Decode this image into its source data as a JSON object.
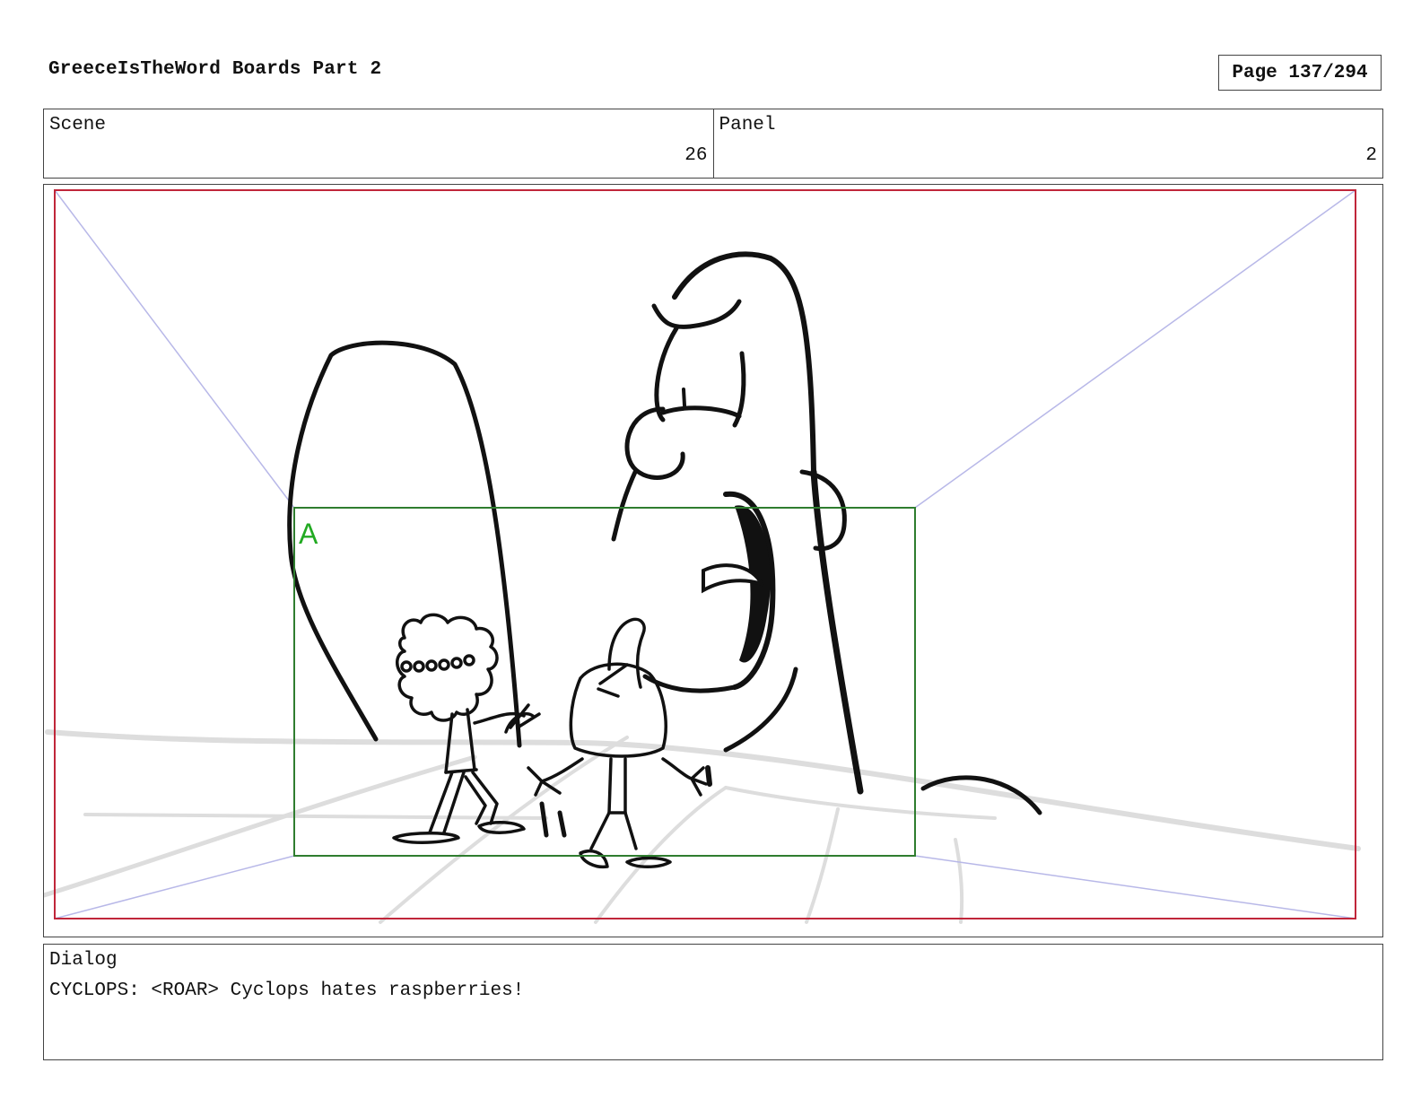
{
  "header": {
    "title": "GreeceIsTheWord Boards Part 2",
    "page_label": "Page 137/294"
  },
  "info": {
    "scene_label": "Scene",
    "scene_value": "26",
    "panel_label": "Panel",
    "panel_value": "2"
  },
  "panel": {
    "camera_marker": "A",
    "colors": {
      "safe_frame": "#c0263a",
      "camera_frame": "#2f7d2f",
      "camera_marker": "#22aa22",
      "perspective": "#b8b8e8",
      "ground": "#dddddd",
      "ink": "#111111"
    }
  },
  "dialog": {
    "label": "Dialog",
    "text": "CYCLOPS: <ROAR> Cyclops hates raspberries!"
  }
}
